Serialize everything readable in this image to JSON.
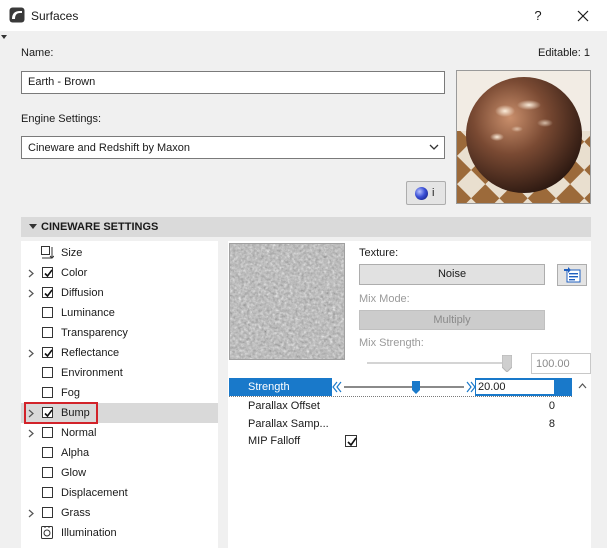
{
  "window": {
    "title": "Surfaces",
    "help_label": "?"
  },
  "form": {
    "name_label": "Name:",
    "editable_label": "Editable: 1",
    "name_value": "Earth - Brown",
    "engine_label": "Engine Settings:",
    "engine_value": "Cineware and Redshift by Maxon",
    "info_label": "i"
  },
  "section": {
    "title": "CINEWARE SETTINGS"
  },
  "channels": [
    {
      "label": "Size",
      "expandable": false,
      "control": "icon",
      "icon": "size-icon",
      "checked": false
    },
    {
      "label": "Color",
      "expandable": true,
      "control": "checkbox",
      "checked": true
    },
    {
      "label": "Diffusion",
      "expandable": true,
      "control": "checkbox",
      "checked": true
    },
    {
      "label": "Luminance",
      "expandable": false,
      "control": "checkbox",
      "checked": false
    },
    {
      "label": "Transparency",
      "expandable": false,
      "control": "checkbox",
      "checked": false
    },
    {
      "label": "Reflectance",
      "expandable": true,
      "control": "checkbox",
      "checked": true
    },
    {
      "label": "Environment",
      "expandable": false,
      "control": "checkbox",
      "checked": false
    },
    {
      "label": "Fog",
      "expandable": false,
      "control": "checkbox",
      "checked": false
    },
    {
      "label": "Bump",
      "expandable": true,
      "control": "checkbox",
      "checked": true,
      "selected": true
    },
    {
      "label": "Normal",
      "expandable": true,
      "control": "checkbox",
      "checked": false
    },
    {
      "label": "Alpha",
      "expandable": false,
      "control": "checkbox",
      "checked": false
    },
    {
      "label": "Glow",
      "expandable": false,
      "control": "checkbox",
      "checked": false
    },
    {
      "label": "Displacement",
      "expandable": false,
      "control": "checkbox",
      "checked": false
    },
    {
      "label": "Grass",
      "expandable": true,
      "control": "checkbox",
      "checked": false
    },
    {
      "label": "Illumination",
      "expandable": false,
      "control": "icon",
      "icon": "illumination-icon",
      "checked": false
    }
  ],
  "texture": {
    "label": "Texture:",
    "value": "Noise",
    "mix_mode_label": "Mix Mode:",
    "mix_mode_value": "Multiply",
    "mix_strength_label": "Mix Strength:",
    "mix_strength_value": "100.00",
    "mix_strength_fraction": 1.0
  },
  "properties": {
    "strength_label": "Strength",
    "strength_value": "20.00",
    "strength_fraction": 0.6,
    "parallax_offset_label": "Parallax Offset",
    "parallax_offset_value": "0",
    "parallax_samples_label": "Parallax Samp...",
    "parallax_samples_value": "8",
    "mip_falloff_label": "MIP Falloff",
    "mip_falloff_checked": true
  },
  "colors": {
    "selection": "#1979ca",
    "highlight_box": "#d2232a",
    "section_header": "#dadada"
  }
}
